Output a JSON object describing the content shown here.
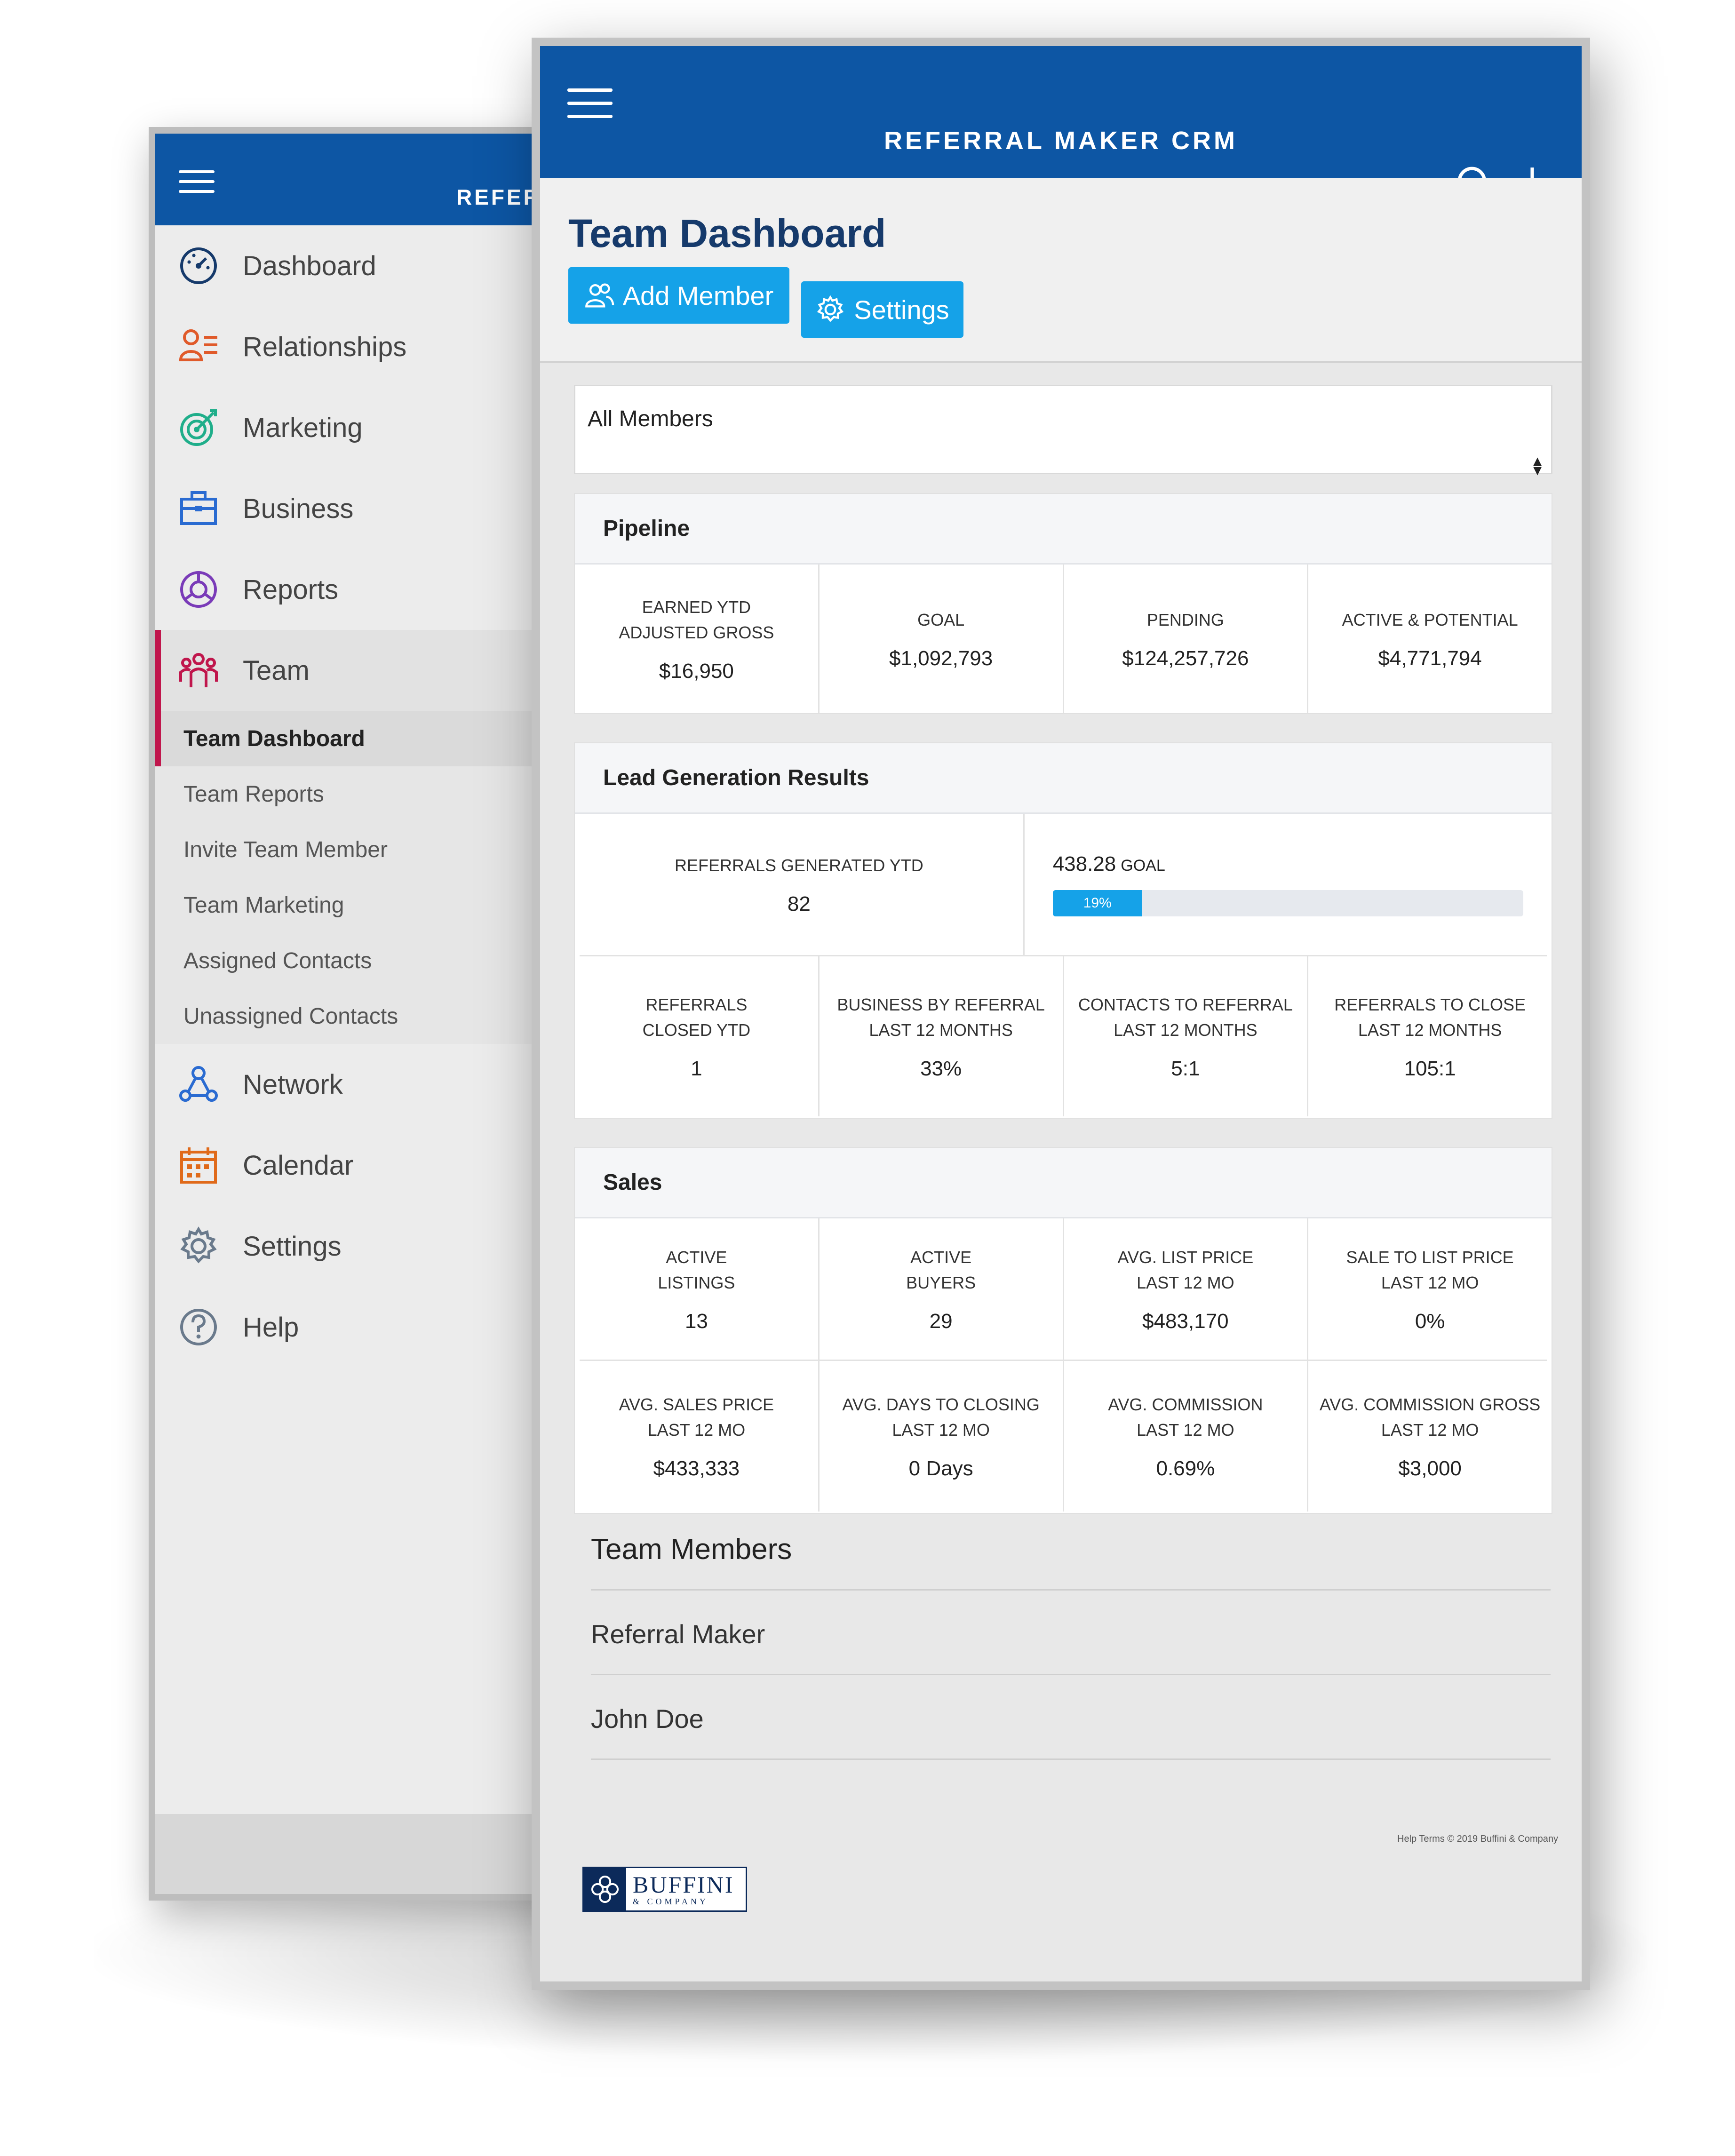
{
  "app": {
    "brand": "REFERRAL MAKER CRM",
    "brand_truncated": "REFERI",
    "accent": "#0d56a4",
    "button_color": "#15a2e8",
    "active_marker": "#c0164c"
  },
  "sidebar": {
    "items": [
      {
        "label": "Dashboard",
        "icon": "speedometer-icon",
        "color": "#163a6b",
        "chevron": false
      },
      {
        "label": "Relationships",
        "icon": "contacts-icon",
        "color": "#e05a2a",
        "chevron": true
      },
      {
        "label": "Marketing",
        "icon": "target-icon",
        "color": "#1fae8a",
        "chevron": true
      },
      {
        "label": "Business",
        "icon": "briefcase-icon",
        "color": "#2a6bd1",
        "chevron": true
      },
      {
        "label": "Reports",
        "icon": "chart-circle-icon",
        "color": "#7a3bb8",
        "chevron": true
      },
      {
        "label": "Team",
        "icon": "team-icon",
        "color": "#c0164c",
        "chevron": true,
        "expanded": true
      },
      {
        "label": "Network",
        "icon": "network-icon",
        "color": "#2a6bd1",
        "chevron": true
      },
      {
        "label": "Calendar",
        "icon": "calendar-icon",
        "color": "#e06a1a",
        "chevron": false
      },
      {
        "label": "Settings",
        "icon": "gear-icon",
        "color": "#6a7a8c",
        "chevron": false
      },
      {
        "label": "Help",
        "icon": "help-icon",
        "color": "#6a7a8c",
        "chevron": true
      }
    ],
    "team_sub": [
      "Team Dashboard",
      "Team Reports",
      "Invite Team Member",
      "Team Marketing",
      "Assigned Contacts",
      "Unassigned Contacts"
    ]
  },
  "page": {
    "title": "Team Dashboard",
    "add_member": "Add Member",
    "settings": "Settings",
    "filter_value": "All Members"
  },
  "pipeline": {
    "title": "Pipeline",
    "cells": [
      {
        "label": "EARNED YTD\nADJUSTED GROSS",
        "value": "$16,950"
      },
      {
        "label": "GOAL",
        "value": "$1,092,793"
      },
      {
        "label": "PENDING",
        "value": "$124,257,726"
      },
      {
        "label": "ACTIVE & POTENTIAL",
        "value": "$4,771,794"
      }
    ]
  },
  "lead_gen": {
    "title": "Lead Generation Results",
    "referrals_generated_label": "REFERRALS GENERATED YTD",
    "referrals_generated_value": "82",
    "goal_value": "438.28",
    "goal_label": "GOAL",
    "progress_percent": 19,
    "progress_text": "19%",
    "cells": [
      {
        "label": "REFERRALS\nCLOSED YTD",
        "value": "1"
      },
      {
        "label": "BUSINESS BY REFERRAL\nLAST 12 MONTHS",
        "value": "33%"
      },
      {
        "label": "CONTACTS TO REFERRAL\nLAST 12 MONTHS",
        "value": "5:1"
      },
      {
        "label": "REFERRALS TO CLOSE\nLAST 12 MONTHS",
        "value": "105:1"
      }
    ]
  },
  "sales": {
    "title": "Sales",
    "row1": [
      {
        "label": "ACTIVE\nLISTINGS",
        "value": "13"
      },
      {
        "label": "ACTIVE\nBUYERS",
        "value": "29"
      },
      {
        "label": "AVG. LIST PRICE\nLAST 12 MO",
        "value": "$483,170"
      },
      {
        "label": "SALE TO LIST PRICE\nLAST 12 MO",
        "value": "0%"
      }
    ],
    "row2": [
      {
        "label": "AVG. SALES PRICE\nLAST 12 MO",
        "value": "$433,333"
      },
      {
        "label": "AVG. DAYS TO CLOSING\nLAST 12 MO",
        "value": "0 Days"
      },
      {
        "label": "AVG. COMMISSION\nLAST 12 MO",
        "value": "0.69%"
      },
      {
        "label": "AVG. COMMISSION GROSS\nLAST 12 MO",
        "value": "$3,000"
      }
    ]
  },
  "members": {
    "title": "Team Members",
    "list": [
      "Referral Maker",
      "John Doe"
    ]
  },
  "footer": {
    "links": "Help Terms © 2019 Buffini & Company",
    "logo_big": "BUFFINI",
    "logo_small": "& COMPANY"
  }
}
